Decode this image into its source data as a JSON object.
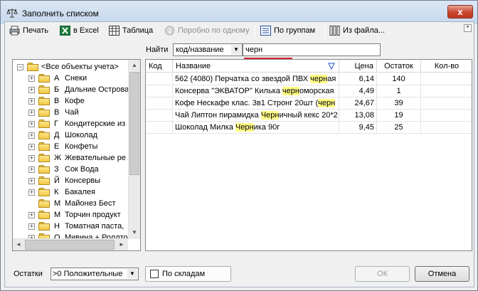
{
  "window": {
    "title": "Заполнить списком",
    "close_label": "x"
  },
  "toolbar": {
    "print": "Печать",
    "excel": "в Excel",
    "table": "Таблица",
    "one_by_one": "Поробно по одному",
    "by_groups": "По группам",
    "from_file": "Из файла...",
    "expand": "+"
  },
  "search": {
    "label": "Найти",
    "mode": "код/название",
    "query": "черн"
  },
  "tree": {
    "root": "<Все объекты учета>",
    "items": [
      {
        "letter": "А",
        "name": "Снеки",
        "expandable": true
      },
      {
        "letter": "Б",
        "name": "Дальние Острова",
        "expandable": true
      },
      {
        "letter": "В",
        "name": "Кофе",
        "expandable": true
      },
      {
        "letter": "В",
        "name": "Чай",
        "expandable": true
      },
      {
        "letter": "Г",
        "name": "Кондитерские из",
        "expandable": true
      },
      {
        "letter": "Д",
        "name": "Шоколад",
        "expandable": true
      },
      {
        "letter": "Е",
        "name": "Конфеты",
        "expandable": true
      },
      {
        "letter": "Ж",
        "name": "Жевательные ре",
        "expandable": true
      },
      {
        "letter": "З",
        "name": "Сок Вода",
        "expandable": true
      },
      {
        "letter": "Й",
        "name": "Консервы",
        "expandable": true
      },
      {
        "letter": "К",
        "name": "Бакалея",
        "expandable": true
      },
      {
        "letter": "М",
        "name": "Майонез Бест",
        "expandable": false
      },
      {
        "letter": "М",
        "name": "Торчин продукт",
        "expandable": true
      },
      {
        "letter": "Н",
        "name": "Томатная паста,",
        "expandable": true
      },
      {
        "letter": "О",
        "name": "Мивина + Роллто",
        "expandable": true
      }
    ]
  },
  "grid": {
    "columns": {
      "code": "Код",
      "name": "Название",
      "price": "Цена",
      "stock": "Остаток",
      "qty": "Кол-во"
    },
    "rows": [
      {
        "code": "",
        "name_pre": "562 (4080) Перчатка со звездой ПВХ ",
        "name_hl": "черн",
        "name_post": "ая",
        "price": "6,14",
        "stock": "140",
        "qty": ""
      },
      {
        "code": "",
        "name_pre": "Консерва \"ЭКВАТОР\" Килька ",
        "name_hl": "черн",
        "name_post": "оморская",
        "price": "4,49",
        "stock": "1",
        "qty": ""
      },
      {
        "code": "",
        "name_pre": "Кофе Нескафе клас. 3в1 Стронг 20шт (",
        "name_hl": "черн",
        "name_post": "",
        "price": "24,67",
        "stock": "39",
        "qty": ""
      },
      {
        "code": "",
        "name_pre": "Чай Липтон пирамидка ",
        "name_hl": "Черн",
        "name_post": "ичный кекс 20*2",
        "price": "13,08",
        "stock": "19",
        "qty": ""
      },
      {
        "code": "",
        "name_pre": "Шоколад Милка ",
        "name_hl": "Черн",
        "name_post": "ика 90г",
        "price": "9,45",
        "stock": "25",
        "qty": ""
      }
    ]
  },
  "footer": {
    "ostatki_label": "Остатки",
    "ostatki_value": ">0  Положительные",
    "by_warehouse": "По складам",
    "ok": "ОК",
    "cancel": "Отмена"
  }
}
